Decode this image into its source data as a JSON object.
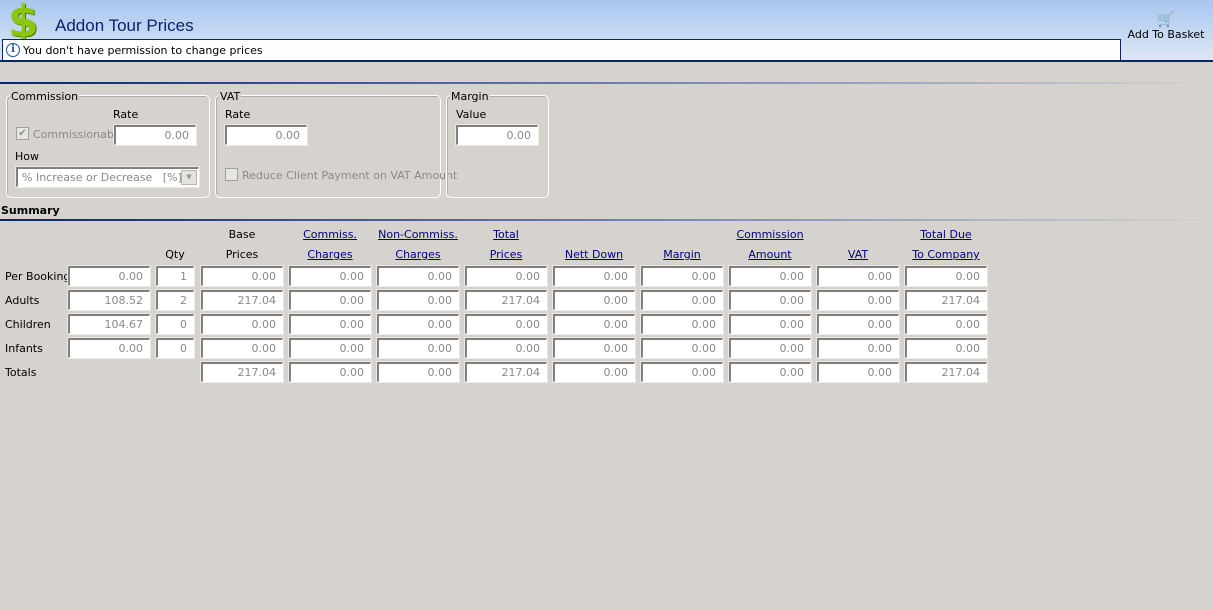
{
  "header": {
    "title": "Addon Tour Prices",
    "message": "You don't have permission to change prices",
    "add_to_basket": "Add To Basket"
  },
  "commission": {
    "legend": "Commission",
    "rate_label": "Rate",
    "commissionable_label": "Commissionable",
    "commissionable_checked": true,
    "rate_value": "0.00",
    "how_label": "How",
    "how_value": "% Increase or Decrease   [%]"
  },
  "vat": {
    "legend": "VAT",
    "rate_label": "Rate",
    "rate_value": "0.00",
    "reduce_label": "Reduce Client Payment on VAT Amount",
    "reduce_checked": false
  },
  "margin": {
    "legend": "Margin",
    "value_label": "Value",
    "value": "0.00"
  },
  "summary": {
    "title": "Summary",
    "columns": [
      {
        "l1": "",
        "l2": "",
        "link": false
      },
      {
        "l1": "",
        "l2": "Qty",
        "link": false
      },
      {
        "l1": "Base",
        "l2": "Prices",
        "link": false
      },
      {
        "l1": "Commiss.",
        "l2": "Charges",
        "link": true
      },
      {
        "l1": "Non-Commiss.",
        "l2": "Charges",
        "link": true
      },
      {
        "l1": "Total",
        "l2": "Prices",
        "link": true
      },
      {
        "l1": "",
        "l2": "Nett Down",
        "link": true
      },
      {
        "l1": "",
        "l2": "Margin",
        "link": true
      },
      {
        "l1": "Commission",
        "l2": "Amount",
        "link": true
      },
      {
        "l1": "",
        "l2": "VAT",
        "link": true
      },
      {
        "l1": "Total Due",
        "l2": "To Company",
        "link": true
      }
    ],
    "rows": [
      {
        "label": "Per Booking",
        "cells": [
          "0.00",
          "1",
          "0.00",
          "0.00",
          "0.00",
          "0.00",
          "0.00",
          "0.00",
          "0.00",
          "0.00",
          "0.00"
        ]
      },
      {
        "label": "Adults",
        "cells": [
          "108.52",
          "2",
          "217.04",
          "0.00",
          "0.00",
          "217.04",
          "0.00",
          "0.00",
          "0.00",
          "0.00",
          "217.04"
        ]
      },
      {
        "label": "Children",
        "cells": [
          "104.67",
          "0",
          "0.00",
          "0.00",
          "0.00",
          "0.00",
          "0.00",
          "0.00",
          "0.00",
          "0.00",
          "0.00"
        ]
      },
      {
        "label": "Infants",
        "cells": [
          "0.00",
          "0",
          "0.00",
          "0.00",
          "0.00",
          "0.00",
          "0.00",
          "0.00",
          "0.00",
          "0.00",
          "0.00"
        ]
      },
      {
        "label": "Totals",
        "cells": [
          "",
          "",
          "217.04",
          "0.00",
          "0.00",
          "217.04",
          "0.00",
          "0.00",
          "0.00",
          "0.00",
          "217.04"
        ]
      }
    ]
  }
}
